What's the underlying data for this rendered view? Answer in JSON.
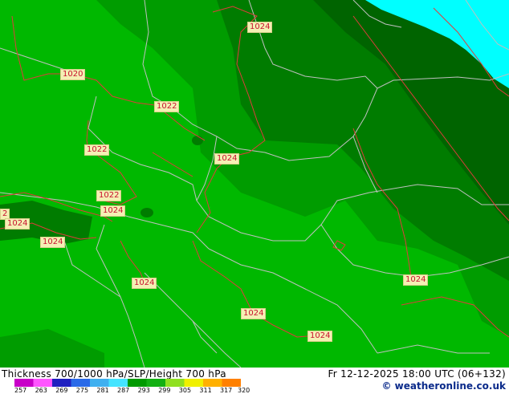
{
  "map": {
    "isobar_labels": [
      {
        "text": "1024"
      },
      {
        "text": "1020"
      },
      {
        "text": "1022"
      },
      {
        "text": "1022"
      },
      {
        "text": "1024"
      },
      {
        "text": "1022"
      },
      {
        "text": "2"
      },
      {
        "text": "1024"
      },
      {
        "text": "1024"
      },
      {
        "text": "1024"
      },
      {
        "text": "1024"
      },
      {
        "text": "1024"
      },
      {
        "text": "1024"
      },
      {
        "text": "1024"
      }
    ]
  },
  "footer": {
    "title": "Thickness 700/1000 hPa/SLP/Height 700 hPa",
    "run": "Fr 12-12-2025 18:00 UTC (06+132)",
    "credit": "© weatheronline.co.uk"
  },
  "legend": {
    "ticks": [
      "257",
      "263",
      "269",
      "275",
      "281",
      "287",
      "293",
      "299",
      "305",
      "311",
      "317",
      "320"
    ],
    "colors": [
      "#c800c8",
      "#ff55ff",
      "#2020c0",
      "#2a6ae8",
      "#3fb0f0",
      "#44e4ff",
      "#009a00",
      "#13b013",
      "#90e020",
      "#f0f000",
      "#ffb000",
      "#ff8000"
    ]
  },
  "colors": {
    "zone_bright": "#00b800",
    "zone_mid": "#009c00",
    "zone_dark": "#007c00",
    "zone_deep": "#006400",
    "sea": "#00ffff",
    "border_line": "#c0c0c0",
    "isobar_line": "#e03c3c"
  }
}
